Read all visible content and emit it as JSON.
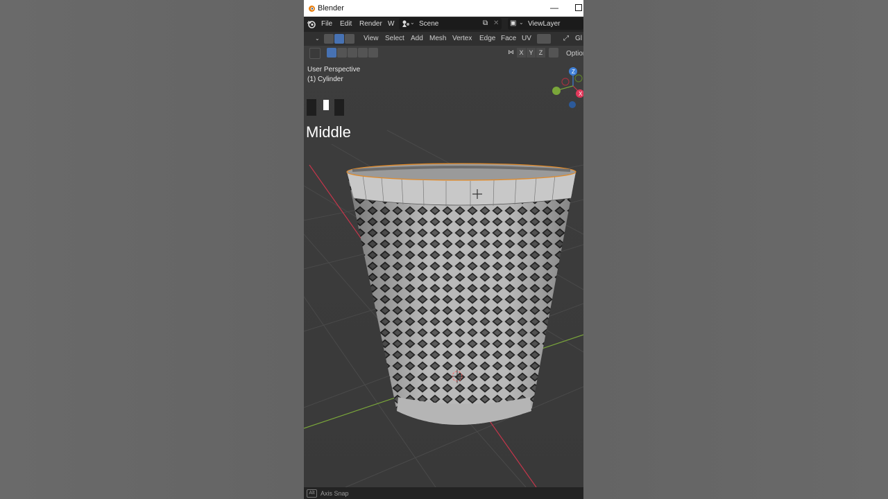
{
  "window": {
    "title": "Blender"
  },
  "topbar": {
    "menus": [
      "File",
      "Edit",
      "Render",
      "W"
    ],
    "scene": "Scene",
    "view_layer": "ViewLayer"
  },
  "header": {
    "menus": [
      "View",
      "Select",
      "Add",
      "Mesh",
      "Vertex",
      "Edge",
      "Face",
      "UV"
    ],
    "transform_orientation": "Gl"
  },
  "toolbar": {
    "axes": [
      "X",
      "Y",
      "Z"
    ],
    "options": "Options"
  },
  "viewport": {
    "perspective": "User Perspective",
    "object": "(1) Cylinder",
    "overlay_caption": "Middle",
    "gizmo_axes": [
      "Z",
      "X"
    ]
  },
  "statusbar": {
    "key": "Alt",
    "hint": "Axis Snap"
  },
  "colors": {
    "selection_edge": "#e08a2a",
    "x_axis": "#c5364b",
    "y_axis": "#7aa63a",
    "z_axis": "#3f7fd6",
    "active_button": "#4772b3"
  }
}
